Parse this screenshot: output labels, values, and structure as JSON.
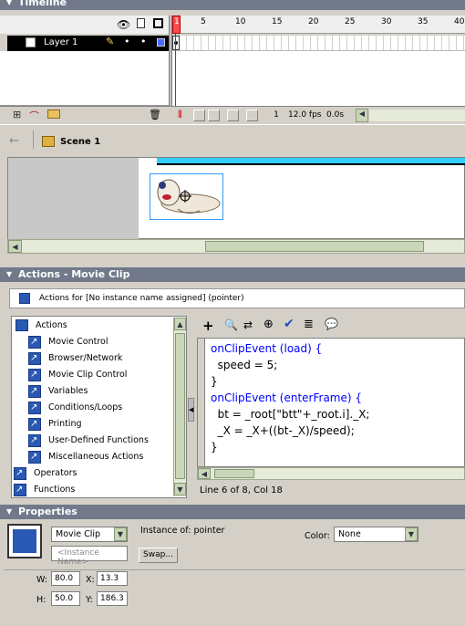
{
  "timeline": {
    "title": "Timeline",
    "layer_name": "Layer 1",
    "ruler": [
      "1",
      "5",
      "10",
      "15",
      "20",
      "25",
      "30",
      "35",
      "40"
    ],
    "current_frame": "1",
    "fps": "12.0 fps",
    "time": "0.0s"
  },
  "scene": {
    "name": "Scene 1"
  },
  "actions": {
    "title": "Actions - Movie Clip",
    "target": "Actions for [No instance name assigned] (pointer)",
    "tree": [
      {
        "label": "Actions",
        "type": "book"
      },
      {
        "label": "Movie Control",
        "type": "item"
      },
      {
        "label": "Browser/Network",
        "type": "item"
      },
      {
        "label": "Movie Clip Control",
        "type": "item"
      },
      {
        "label": "Variables",
        "type": "item"
      },
      {
        "label": "Conditions/Loops",
        "type": "item"
      },
      {
        "label": "Printing",
        "type": "item"
      },
      {
        "label": "User-Defined Functions",
        "type": "item"
      },
      {
        "label": "Miscellaneous Actions",
        "type": "item"
      },
      {
        "label": "Operators",
        "type": "item"
      },
      {
        "label": "Functions",
        "type": "item"
      }
    ],
    "code": [
      "onClipEvent (load) {",
      "  speed = 5;",
      "}",
      "onClipEvent (enterFrame) {",
      "  bt = _root[\"btt\"+_root.i]._X;",
      "  _X = _X+((bt-_X)/speed);",
      "}"
    ],
    "status": "Line 6 of 8, Col 18"
  },
  "properties": {
    "title": "Properties",
    "symbol_type": "Movie Clip",
    "instance_name_placeholder": "<Instance Name>",
    "instance_of_label": "Instance of:",
    "instance_of_value": "pointer",
    "swap_label": "Swap...",
    "color_label": "Color:",
    "color_value": "None",
    "w_label": "W:",
    "w_value": "80.0",
    "h_label": "H:",
    "h_value": "50.0",
    "x_label": "X:",
    "x_value": "13.3",
    "y_label": "Y:",
    "y_value": "186.3"
  },
  "colors": {
    "panel_title": "#71798a",
    "playhead": "#ff0000",
    "stage_bar": "#33ccff",
    "keyword": "#0000ff"
  }
}
